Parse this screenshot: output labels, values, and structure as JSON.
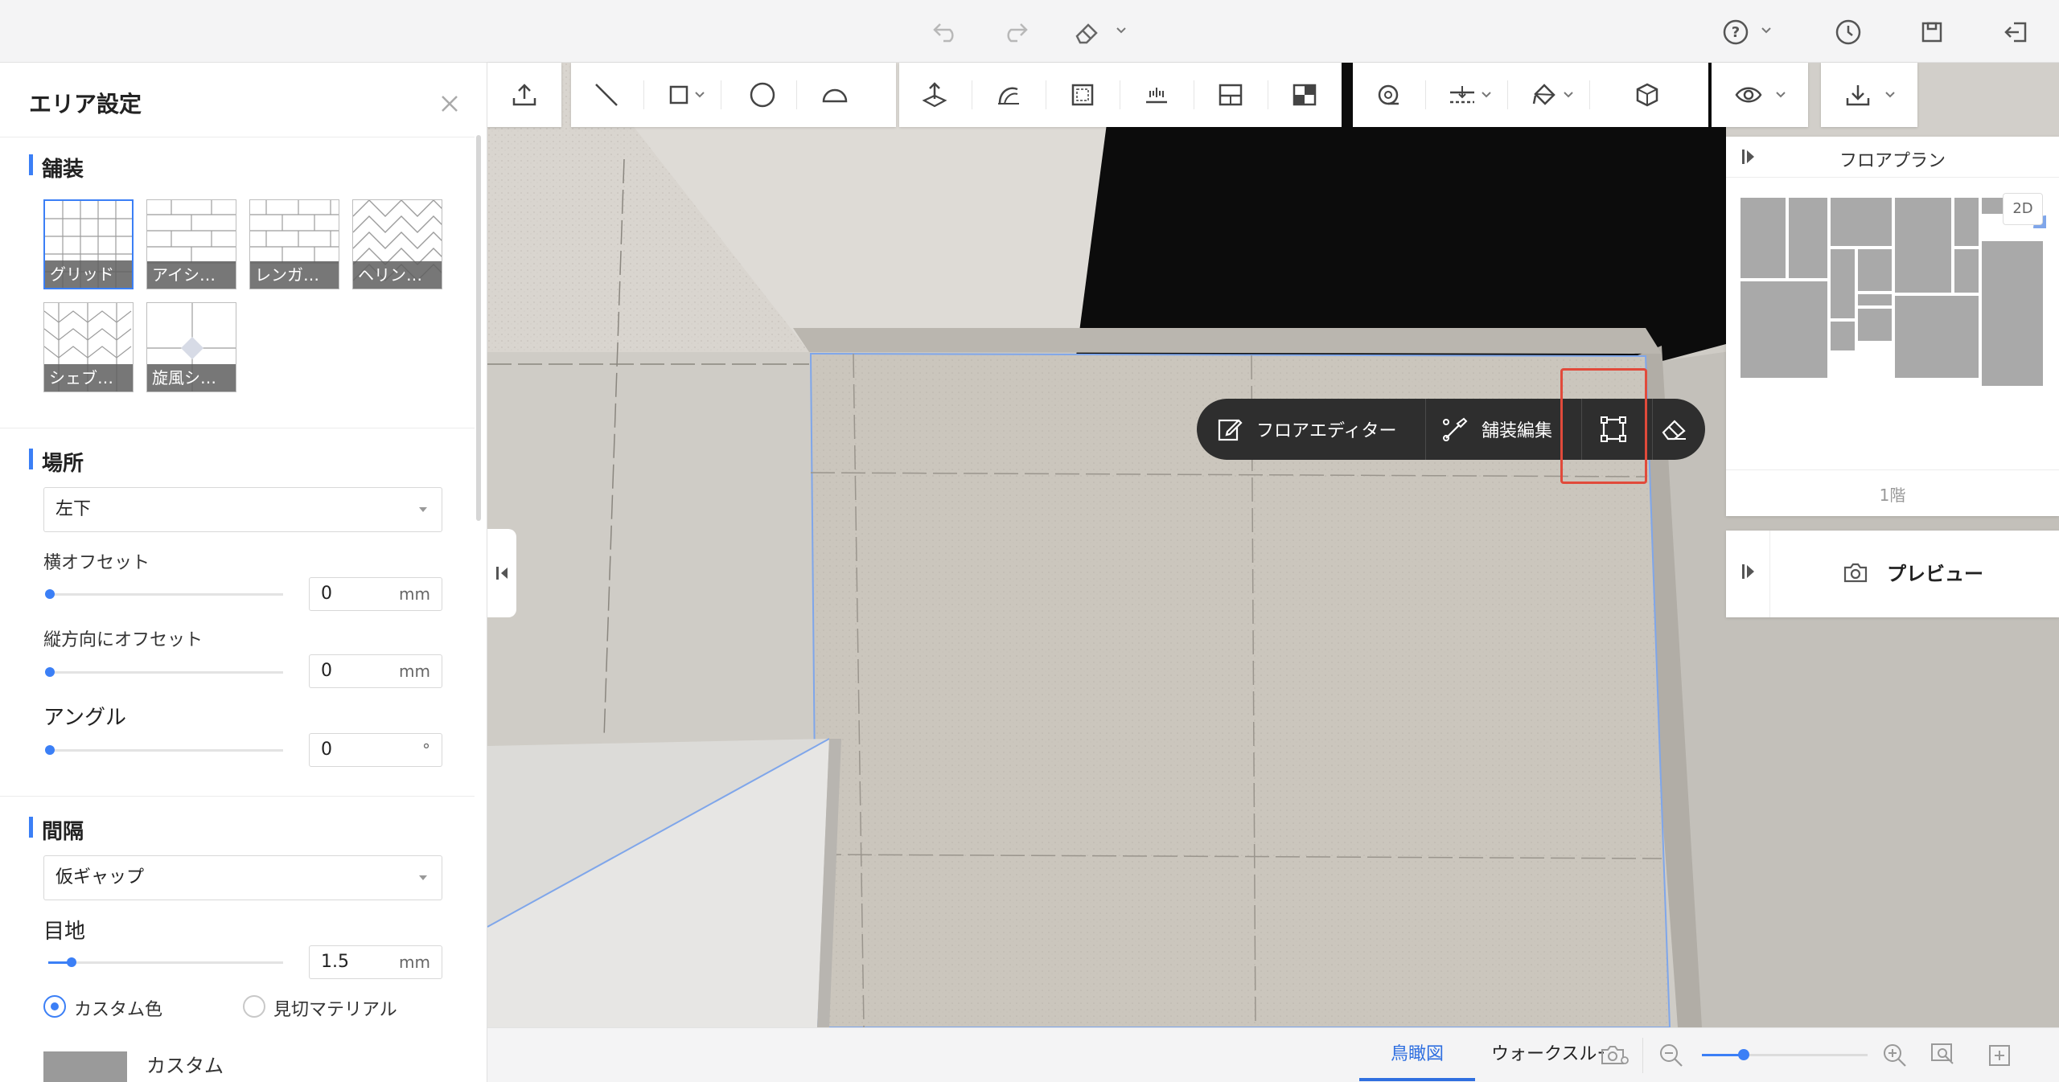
{
  "panel": {
    "title": "エリア設定",
    "paving": {
      "title": "舗装",
      "patterns": [
        "グリッド",
        "アイシ…",
        "レンガ…",
        "ヘリン…",
        "シェブ…",
        "旋風シ…"
      ],
      "selected": "グリッド"
    },
    "location": {
      "title": "場所",
      "anchor": "左下",
      "h_offset_label": "横オフセット",
      "h_offset_value": "0",
      "v_offset_label": "縦方向にオフセット",
      "v_offset_value": "0",
      "angle_label": "アングル",
      "angle_value": "0",
      "unit_mm": "mm",
      "unit_deg": "°"
    },
    "spacing": {
      "title": "間隔",
      "gap_type": "仮ギャップ",
      "joint_label": "目地",
      "joint_value": "1.5",
      "joint_fraction": 0.1,
      "unit_mm": "mm",
      "custom_color_label": "カスタム色",
      "material_label": "見切マテリアル",
      "swatch_label": "カスタム",
      "swatch_color": "#9a9a9a"
    }
  },
  "context_bar": {
    "floor_editor": "フロアエディター",
    "paving_edit": "舗装編集"
  },
  "floorplan": {
    "title": "フロアプラン",
    "badge": "2D",
    "floor": "1階"
  },
  "preview": {
    "title": "プレビュー"
  },
  "bottom": {
    "tab_birdseye": "鳥瞰図",
    "tab_walkthrough": "ウォークスルー",
    "zoom_fraction": 0.25
  },
  "colors": {
    "accent": "#3b7ff6",
    "highlight": "#e14a3b",
    "context_bar": "#2e2e2e"
  }
}
